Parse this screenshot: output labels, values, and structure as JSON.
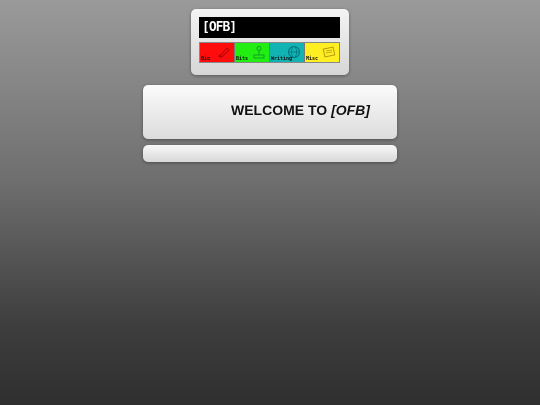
{
  "site": {
    "logo_text": "[OFB]"
  },
  "nav": {
    "items": [
      {
        "label": "Bio",
        "color": "#ff0d0d",
        "icon": "paint-icon"
      },
      {
        "label": "Bits",
        "color": "#22ee11",
        "icon": "joystick-icon"
      },
      {
        "label": "Writing",
        "color": "#11b3b3",
        "icon": "globe-icon"
      },
      {
        "label": "Misc",
        "color": "#ffee22",
        "icon": "note-icon"
      }
    ]
  },
  "welcome": {
    "prefix": "WELCOME TO ",
    "site_name": "[OFB]"
  }
}
